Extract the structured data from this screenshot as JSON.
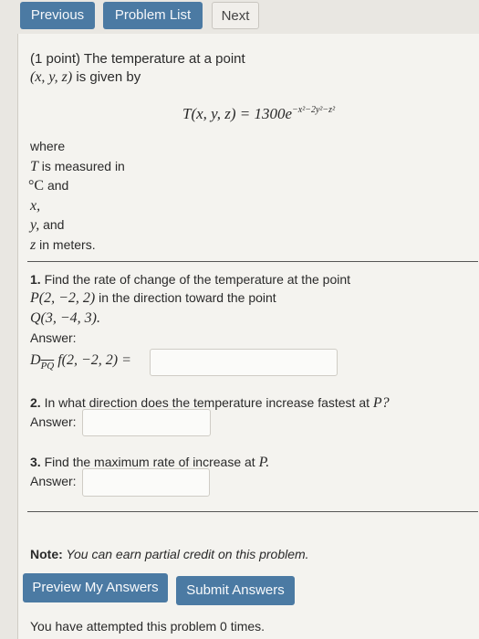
{
  "nav": {
    "previous": "Previous",
    "problem_list": "Problem List",
    "next": "Next"
  },
  "intro": {
    "points": "(1 point) The temperature at a point",
    "point_vars": "(x, y, z)",
    "given_by": " is given by",
    "formula_lhs": "T(x, y, z) = 1300e",
    "formula_exp": "−x²−2y²−z²",
    "where": "where",
    "t_var": "T",
    "t_measured": " is measured in",
    "deg": "°C",
    "and1": " and",
    "x_var": "x,",
    "y_var": "y,",
    "and2": " and",
    "z_var": "z",
    "in_meters": " in meters."
  },
  "q1": {
    "number": "1.",
    "text": " Find the rate of change of the temperature at the point",
    "point_p": "P(2, −2, 2)",
    "direction_text": " in the direction toward the point",
    "point_q": "Q(3, −4, 3).",
    "answer_label": "Answer:",
    "expr": "f(2, −2, 2) ="
  },
  "q2": {
    "number": "2.",
    "text": " In what direction does the temperature increase fastest at ",
    "point": "P?",
    "answer_label": "Answer:"
  },
  "q3": {
    "number": "3.",
    "text": " Find the maximum rate of increase at ",
    "point": "P.",
    "answer_label": "Answer:"
  },
  "note": {
    "label": "Note:",
    "text": " You can earn partial credit on this problem."
  },
  "actions": {
    "preview": "Preview My Answers",
    "submit": "Submit Answers"
  },
  "footer": {
    "attempts": "You have attempted this problem 0 times."
  }
}
